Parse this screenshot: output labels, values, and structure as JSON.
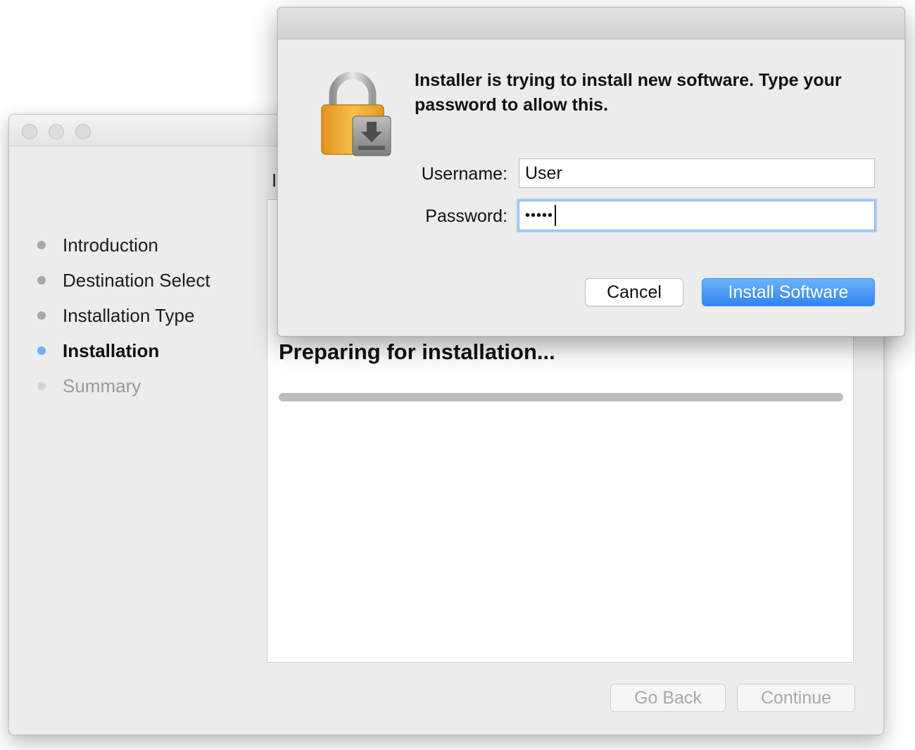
{
  "installer": {
    "heading_partial": "I",
    "steps": [
      {
        "label": "Introduction",
        "state": "done"
      },
      {
        "label": "Destination Select",
        "state": "done"
      },
      {
        "label": "Installation Type",
        "state": "done"
      },
      {
        "label": "Installation",
        "state": "active"
      },
      {
        "label": "Summary",
        "state": "pending"
      }
    ],
    "status_text": "Preparing for installation...",
    "progress": 0,
    "buttons": {
      "go_back": "Go Back",
      "continue": "Continue"
    }
  },
  "auth_dialog": {
    "message": "Installer is trying to install new software. Type your password to allow this.",
    "username_label": "Username:",
    "username_value": "User",
    "password_label": "Password:",
    "password_masked": "•••••",
    "buttons": {
      "cancel": "Cancel",
      "install": "Install Software"
    },
    "icon": "lock-icon"
  },
  "colors": {
    "accent": "#2f84f2",
    "active_step": "#6aaef3",
    "window_bg": "#ececec"
  }
}
